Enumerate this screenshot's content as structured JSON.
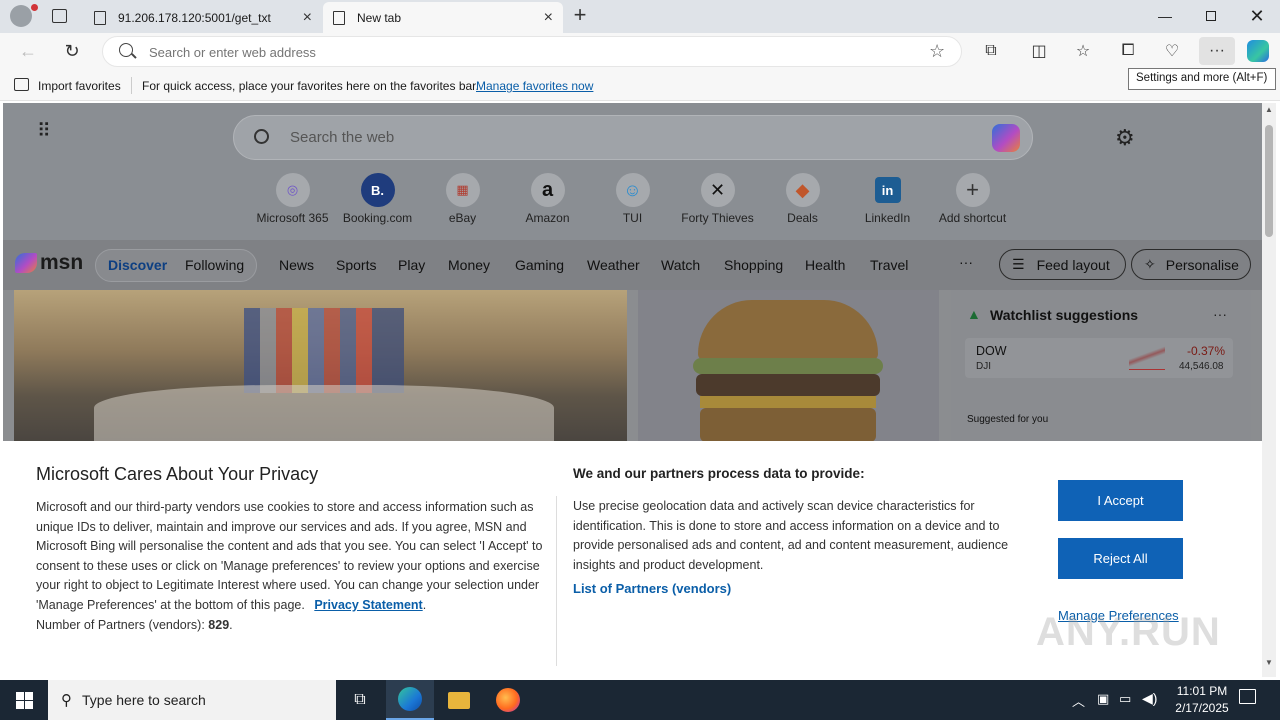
{
  "browser": {
    "tabs": [
      {
        "label": "91.206.178.120:5001/get_txt",
        "active": false
      },
      {
        "label": "New tab",
        "active": true
      }
    ],
    "address_placeholder": "Search or enter web address",
    "tooltip": "Settings and more (Alt+F)",
    "favorites_bar": {
      "import_label": "Import favorites",
      "hint_text": "For quick access, place your favorites here on the favorites bar.",
      "manage_link": "Manage favorites now"
    }
  },
  "newtab": {
    "search_placeholder": "Search the web",
    "shortcuts": [
      {
        "label": "Microsoft 365",
        "glyph": "◎"
      },
      {
        "label": "Booking.com",
        "glyph": "B."
      },
      {
        "label": "eBay",
        "glyph": "▦"
      },
      {
        "label": "Amazon",
        "glyph": "a"
      },
      {
        "label": "TUI",
        "glyph": "☺"
      },
      {
        "label": "Forty Thieves",
        "glyph": "✕"
      },
      {
        "label": "Deals",
        "glyph": "◆"
      },
      {
        "label": "LinkedIn",
        "glyph": "in"
      },
      {
        "label": "Add shortcut",
        "glyph": "+"
      }
    ],
    "msn": {
      "logo": "msn",
      "tabs": [
        "Discover",
        "Following"
      ],
      "nav": [
        "News",
        "Sports",
        "Play",
        "Money",
        "Gaming",
        "Weather",
        "Watch",
        "Shopping",
        "Health",
        "Travel"
      ],
      "more": "···",
      "feed_layout": "Feed layout",
      "personalise": "Personalise"
    },
    "watchlist": {
      "title": "Watchlist suggestions",
      "more": "···",
      "stock": {
        "symbol": "DOW",
        "exchange": "DJI",
        "change": "-0.37%",
        "price": "44,546.08"
      },
      "suggested_label": "Suggested for you"
    }
  },
  "privacy": {
    "title": "Microsoft Cares About Your Privacy",
    "body": "Microsoft and our third-party vendors use cookies to store and access information such as unique IDs to deliver, maintain and improve our services and ads. If you agree, MSN and Microsoft Bing will personalise the content and ads that you see. You can select 'I Accept' to consent to these uses or click on 'Manage preferences' to review your options and exercise your right to object to Legitimate Interest where used.  You can change your selection under 'Manage Preferences' at the bottom of this page.",
    "privacy_link": "Privacy Statement",
    "partners_count_label": "Number of Partners (vendors):",
    "partners_count": "829",
    "right_title": "We and our partners process data to provide:",
    "right_body": "Use precise geolocation data and actively scan device characteristics for identification. This is done to store and access information on a device and to provide personalised ads and content, ad and content measurement, audience insights and product development.",
    "partners_link": "List of Partners (vendors)",
    "accept": "I Accept",
    "reject": "Reject All",
    "manage": "Manage Preferences"
  },
  "taskbar": {
    "search_placeholder": "Type here to search",
    "time": "11:01 PM",
    "date": "2/17/2025"
  },
  "watermark": "ANY.RUN",
  "colors": {
    "accent": "#0f62b6",
    "link": "#0a5ea8",
    "taskbar": "#1b2734",
    "stock_down": "#c42b1c"
  }
}
